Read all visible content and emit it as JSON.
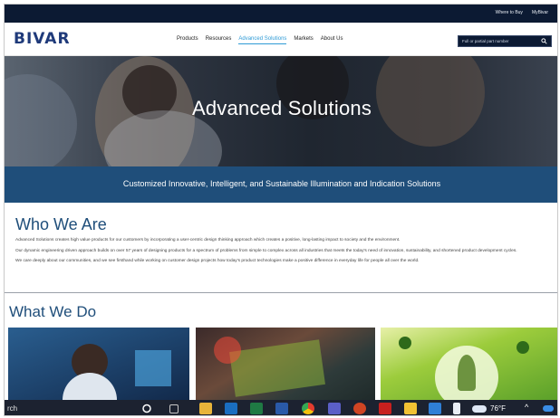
{
  "topbar": {
    "links": [
      "Where to Buy",
      "MyBivar"
    ]
  },
  "header": {
    "logo": "BIVAR",
    "menu": [
      {
        "label": "Products",
        "active": false
      },
      {
        "label": "Resources",
        "active": false
      },
      {
        "label": "Advanced Solutions",
        "active": true
      },
      {
        "label": "Markets",
        "active": false
      },
      {
        "label": "About Us",
        "active": false
      }
    ],
    "search_placeholder": "Full or partial part number"
  },
  "hero": {
    "title": "Advanced Solutions"
  },
  "band": {
    "text": "Customized Innovative, Intelligent, and Sustainable Illumination and Indication Solutions"
  },
  "who": {
    "title": "Who We Are",
    "paragraphs": [
      "Advanced Solutions creates high value products for our customers by incorporating a user-centric design thinking approach which creates a positive, long-lasting impact to society and the environment.",
      "Our dynamic engineering driven approach builds on over 57 years of designing products for a spectrum of problems from simple to complex across all industries that meets the today's need of innovation, sustainability, and shortened product development cycles.",
      "We care deeply about our communities, and we see firsthand while working on customer design projects how today's product technologies make a positive difference in everyday life for people all over the world."
    ]
  },
  "what": {
    "title": "What We Do"
  },
  "taskbar": {
    "search_text": "rch",
    "temperature": "76°F"
  },
  "colors": {
    "navy": "#0c1a33",
    "brand_blue": "#1f4e7a",
    "accent": "#2f9bd6"
  }
}
